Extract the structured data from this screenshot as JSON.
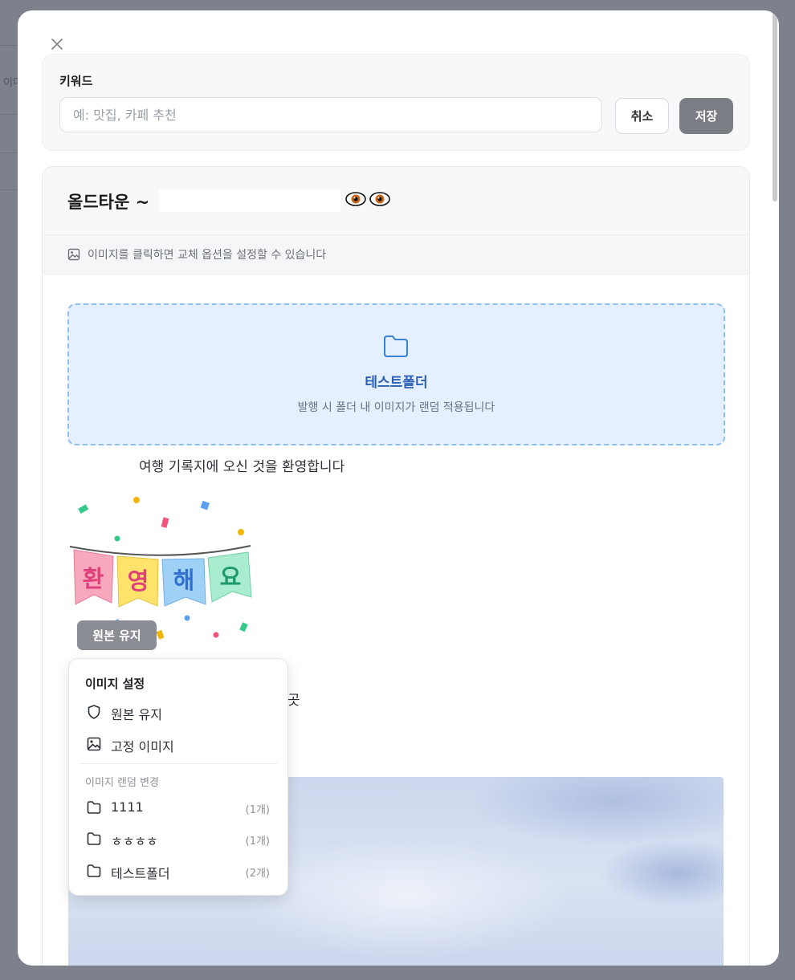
{
  "background": {
    "fragment_text": "이미"
  },
  "modal": {
    "close_icon": "close-icon",
    "keyword": {
      "label": "키워드",
      "placeholder": "예: 맛집, 카페 추천",
      "value": "",
      "cancel_label": "취소",
      "save_label": "저장"
    },
    "preview": {
      "title": "올드타운 ~",
      "title_emoji": "👁👁",
      "hint": "이미지를 클릭하면 교체 옵션을 설정할 수 있습니다",
      "folder_block": {
        "name": "테스트폴더",
        "description": "발행 시 폴더 내 이미지가 랜덤 적용됩니다"
      },
      "welcome_text": "여행 기록지에 오신 것을 환영합니다",
      "welcome_art_text": "환영해요",
      "image_badge": "원본 유지",
      "partial_text": "곳"
    },
    "image_menu": {
      "title": "이미지 설정",
      "options": [
        {
          "label": "원본 유지",
          "icon": "shield-icon"
        },
        {
          "label": "고정 이미지",
          "icon": "image-icon"
        }
      ],
      "random_section_label": "이미지 랜덤 변경",
      "folders": [
        {
          "label": "1111",
          "count": "(1개)",
          "icon": "folder-icon"
        },
        {
          "label": "ㅎㅎㅎㅎ",
          "count": "(1개)",
          "icon": "folder-icon"
        },
        {
          "label": "테스트폴더",
          "count": "(2개)",
          "icon": "folder-icon"
        }
      ]
    }
  },
  "colors": {
    "accent_blue": "#2a5fb3",
    "folder_bg": "#e4efff",
    "save_button": "#7a7d84"
  }
}
